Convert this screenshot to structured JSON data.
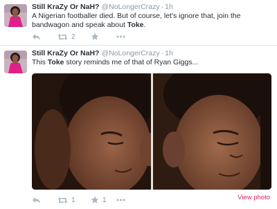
{
  "tweets": [
    {
      "fullname": "Still KraZy Or NaH?",
      "username": "@NoLongerCrazy",
      "separator": "·",
      "time": "1h",
      "text_before": "A Nigerian footballer died. But of course, let's ignore that, join the bandwagon and speak about ",
      "text_keyword": "Toke",
      "text_after": ".",
      "retweet_count": "2",
      "fav_count": ""
    },
    {
      "fullname": "Still KraZy Or NaH?",
      "username": "@NoLongerCrazy",
      "separator": "·",
      "time": "1h",
      "text_before": "This ",
      "text_keyword": "Toke",
      "text_after": " story reminds me of that of Ryan Giggs...",
      "retweet_count": "1",
      "fav_count": "1",
      "view_photo": "View photo"
    }
  ],
  "icons": {
    "reply": "reply-icon",
    "retweet": "retweet-icon",
    "favorite": "star-icon",
    "more": "more-icon"
  },
  "colors": {
    "name": "#292f33",
    "meta": "#8899a6",
    "action": "#aab8c2",
    "link": "#e0245e"
  }
}
